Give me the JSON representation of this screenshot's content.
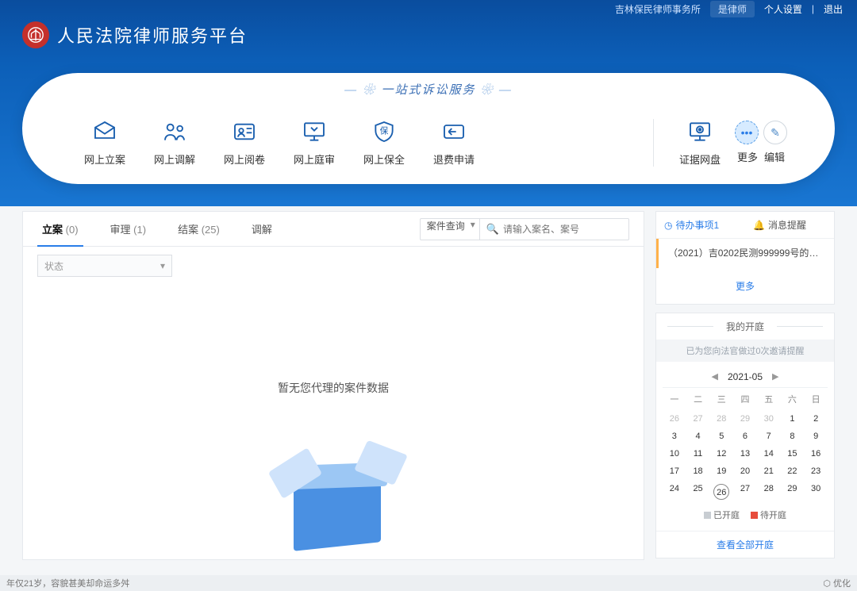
{
  "top": {
    "org": "吉林保民律师事务所",
    "role": "是律师",
    "settings": "个人设置",
    "logout": "退出"
  },
  "site_title": "人民法院律师服务平台",
  "panel_tag": "一站式诉讼服务",
  "services": [
    {
      "label": "网上立案"
    },
    {
      "label": "网上调解"
    },
    {
      "label": "网上阅卷"
    },
    {
      "label": "网上庭审"
    },
    {
      "label": "网上保全"
    },
    {
      "label": "退费申请"
    }
  ],
  "evidence_label": "证据网盘",
  "more_label": "更多",
  "edit_label": "编辑",
  "tabs": [
    {
      "label": "立案",
      "count": "(0)"
    },
    {
      "label": "审理",
      "count": "(1)"
    },
    {
      "label": "结案",
      "count": "(25)"
    },
    {
      "label": "调解",
      "count": ""
    }
  ],
  "search_mode": "案件查询",
  "search_placeholder": "请输入案名、案号",
  "status_label": "状态",
  "empty_text": "暂无您代理的案件数据",
  "todo": {
    "tab1": "待办事项1",
    "tab2": "消息提醒",
    "item": "（2021）吉0202民测999999号的开...",
    "more": "更多"
  },
  "court": {
    "title": "我的开庭",
    "band": "已为您向法官做过0次邀请提醒",
    "month": "2021-05",
    "weekdays": [
      "一",
      "二",
      "三",
      "四",
      "五",
      "六",
      "日"
    ],
    "days": [
      {
        "n": "26",
        "o": true
      },
      {
        "n": "27",
        "o": true
      },
      {
        "n": "28",
        "o": true
      },
      {
        "n": "29",
        "o": true
      },
      {
        "n": "30",
        "o": true
      },
      {
        "n": "1"
      },
      {
        "n": "2"
      },
      {
        "n": "3"
      },
      {
        "n": "4"
      },
      {
        "n": "5"
      },
      {
        "n": "6"
      },
      {
        "n": "7"
      },
      {
        "n": "8"
      },
      {
        "n": "9"
      },
      {
        "n": "10"
      },
      {
        "n": "11"
      },
      {
        "n": "12"
      },
      {
        "n": "13"
      },
      {
        "n": "14"
      },
      {
        "n": "15"
      },
      {
        "n": "16"
      },
      {
        "n": "17"
      },
      {
        "n": "18"
      },
      {
        "n": "19"
      },
      {
        "n": "20"
      },
      {
        "n": "21"
      },
      {
        "n": "22"
      },
      {
        "n": "23"
      },
      {
        "n": "24"
      },
      {
        "n": "25"
      },
      {
        "n": "26",
        "t": true
      },
      {
        "n": "27"
      },
      {
        "n": "28"
      },
      {
        "n": "29"
      },
      {
        "n": "30"
      }
    ],
    "legend_done": "已开庭",
    "legend_wait": "待开庭",
    "view_all": "查看全部开庭"
  },
  "footer_left": "年仅21岁，容貌甚美却命运多舛",
  "footer_right": "优化"
}
